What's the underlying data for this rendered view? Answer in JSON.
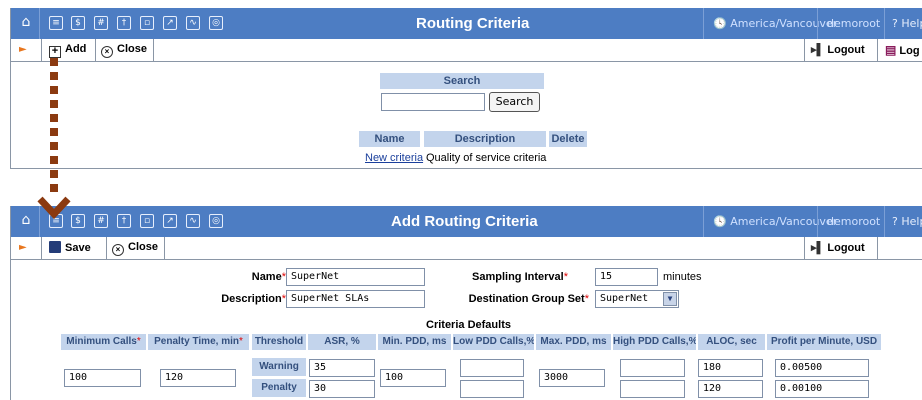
{
  "colors": {
    "titlebar": "#4d7dc3",
    "header_cell": "#c3d4ec",
    "required": "#dd0000",
    "link": "#1a3f9c",
    "connector": "#8b3a10"
  },
  "nav_icons": [
    "home-icon",
    "list-icon",
    "dollar-icon",
    "grid-icon",
    "person-icon",
    "split-icon",
    "route-icon",
    "chart-icon",
    "search-icon"
  ],
  "screen1": {
    "title": "Routing Criteria",
    "timezone": "America/Vancouver",
    "user": "demoroot",
    "help": "Help",
    "toolbar": {
      "add": "Add",
      "close": "Close",
      "logout": "Logout",
      "log": "Log"
    },
    "search": {
      "heading": "Search",
      "value": "",
      "button": "Search"
    },
    "table": {
      "columns": [
        "Name",
        "Description",
        "Delete"
      ],
      "rows": [
        {
          "name": "New criteria",
          "description": "Quality of service criteria",
          "delete": ""
        }
      ]
    }
  },
  "screen2": {
    "title": "Add Routing Criteria",
    "timezone": "America/Vancouver",
    "user": "demoroot",
    "help": "Help",
    "toolbar": {
      "save": "Save",
      "close": "Close",
      "logout": "Logout"
    },
    "form": {
      "name_label": "Name",
      "name_value": "SuperNet",
      "description_label": "Description",
      "description_value": "SuperNet SLAs",
      "sampling_label": "Sampling Interval",
      "sampling_value": "15",
      "sampling_unit": "minutes",
      "dest_label": "Destination Group Set",
      "dest_value": "SuperNet"
    },
    "criteria": {
      "title": "Criteria Defaults",
      "columns": [
        "Minimum Calls",
        "Penalty Time, min",
        "Threshold",
        "ASR, %",
        "Min. PDD, ms",
        "Low PDD Calls,%",
        "Max. PDD, ms",
        "High PDD Calls,%",
        "ALOC, sec",
        "Profit per Minute, USD"
      ],
      "min_calls": "100",
      "penalty_time": "120",
      "min_pdd": "100",
      "max_pdd": "3000",
      "rows": [
        {
          "threshold": "Warning",
          "asr": "35",
          "low_pdd": "",
          "high_pdd": "",
          "aloc": "180",
          "profit": "0.00500"
        },
        {
          "threshold": "Penalty",
          "asr": "30",
          "low_pdd": "",
          "high_pdd": "",
          "aloc": "120",
          "profit": "0.00100"
        }
      ]
    }
  }
}
